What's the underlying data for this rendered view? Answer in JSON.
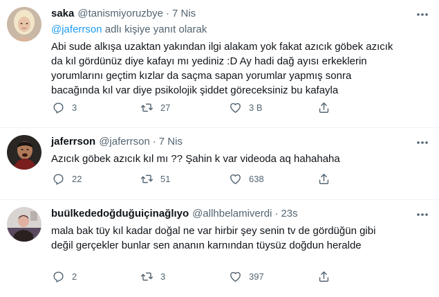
{
  "tweets": [
    {
      "display_name": "saka",
      "handle": "@tanismiyoruzbye",
      "dot": "·",
      "time": "7 Nis",
      "reply_mention": "@jaferrson",
      "reply_suffix": " adlı kişiye yanıt olarak",
      "text": "Abi sude alkışa uzaktan yakından ilgi alakam yok fakat azıcık göbek azıcık\nda kıl gördünüz diye kafayı mı yediniz :D Ay hadi dağ ayısı erkeklerin\nyorumlarını geçtim kızlar da saçma sapan yorumlar yapmış sonra\nbacağında kıl var diye psikolojik şiddet göreceksiniz bu kafayla",
      "replies": "3",
      "retweets": "27",
      "likes": "3 B"
    },
    {
      "display_name": "jaferrson",
      "handle": "@jaferrson",
      "dot": "·",
      "time": "7 Nis",
      "text": "Azıcık göbek azıcık kıl mı ?? Şahin k var videoda aq hahahaha",
      "replies": "22",
      "retweets": "51",
      "likes": "638"
    },
    {
      "display_name": "buülkededoğduğuiçinağlıyo",
      "handle": "@allhbelamiverdi",
      "dot": "·",
      "time": "23s",
      "text": "mala bak tüy kıl kadar doğal ne var hirbir şey senin tv de gördüğün gibi\ndeğil  gerçekler bunlar sen ananın karnından tüysüz doğdun heralde",
      "replies": "2",
      "retweets": "3",
      "likes": "397"
    }
  ],
  "colors": {
    "text": "#0f1419",
    "secondary": "#536471",
    "link": "#1d9bf0",
    "divider": "#eff3f4"
  }
}
